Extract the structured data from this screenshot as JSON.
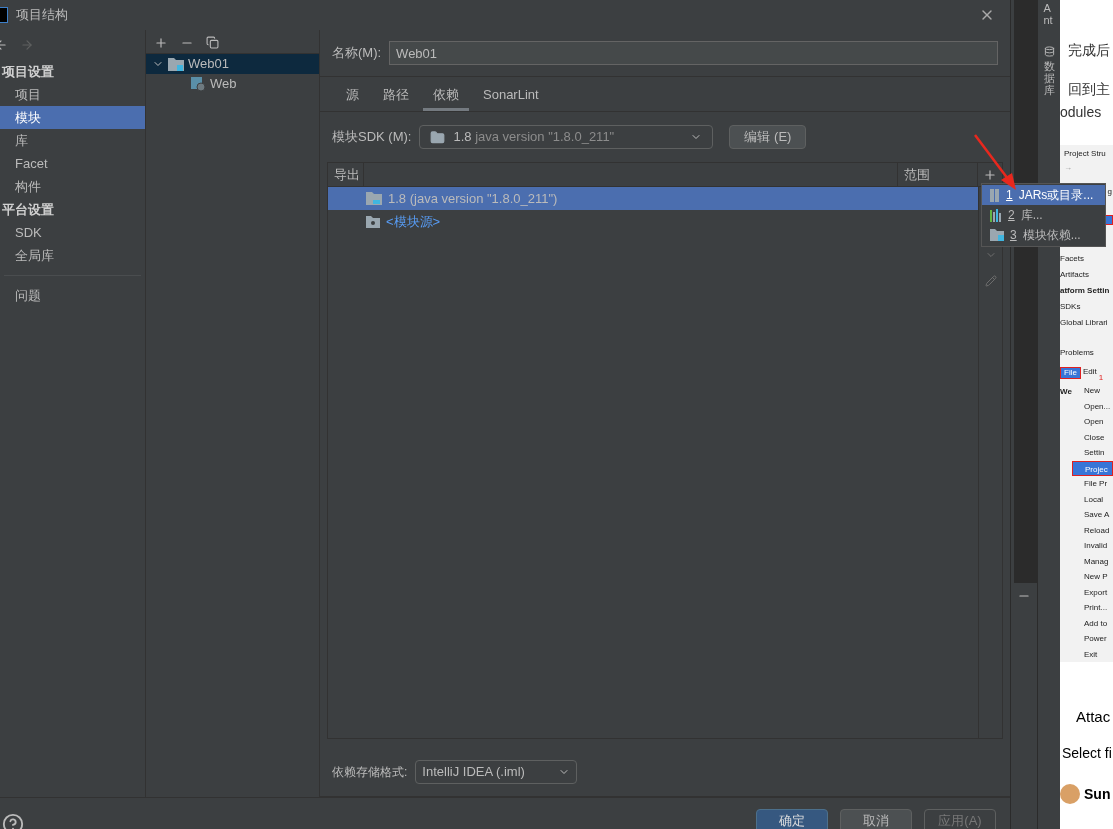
{
  "window": {
    "title": "项目结构"
  },
  "nav": {
    "items": [
      {
        "label": "项目设置",
        "kind": "header"
      },
      {
        "label": "项目",
        "kind": "item",
        "selected": false
      },
      {
        "label": "模块",
        "kind": "item",
        "selected": true
      },
      {
        "label": "库",
        "kind": "item",
        "selected": false
      },
      {
        "label": "Facet",
        "kind": "item",
        "selected": false
      },
      {
        "label": "构件",
        "kind": "item",
        "selected": false
      },
      {
        "label": "平台设置",
        "kind": "header"
      },
      {
        "label": "SDK",
        "kind": "item",
        "selected": false
      },
      {
        "label": "全局库",
        "kind": "item",
        "selected": false
      },
      {
        "kind": "divider"
      },
      {
        "label": "问题",
        "kind": "item",
        "selected": false
      }
    ]
  },
  "module_tree": [
    {
      "label": "Web01",
      "kind": "module",
      "expanded": true,
      "selected": true,
      "children": [
        {
          "label": "Web",
          "kind": "facet",
          "selected": false
        }
      ]
    }
  ],
  "name_field": {
    "label": "名称(M):",
    "value": "Web01"
  },
  "tabs": [
    {
      "label": "源",
      "selected": false
    },
    {
      "label": "路径",
      "selected": false
    },
    {
      "label": "依赖",
      "selected": true
    },
    {
      "label": "SonarLint",
      "selected": false
    }
  ],
  "sdk": {
    "label": "模块SDK (M):",
    "version": "1.8",
    "detail": "java version \"1.8.0_211\"",
    "edit_button": "编辑 (E)"
  },
  "table": {
    "columns": [
      "导出",
      "范围"
    ],
    "rows": [
      {
        "label": "1.8 (java version \"1.8.0_211\")",
        "kind": "sdk",
        "selected": true
      },
      {
        "label": "<模块源>",
        "kind": "source",
        "selected": false
      }
    ]
  },
  "add_menu": [
    {
      "number": "1",
      "label": "JARs或目录...",
      "kind": "jar",
      "selected": true
    },
    {
      "number": "2",
      "label": "库...",
      "kind": "library",
      "selected": false
    },
    {
      "number": "3",
      "label": "模块依赖...",
      "kind": "module",
      "selected": false
    }
  ],
  "storage_format": {
    "label": "依赖存储格式:",
    "value": "IntelliJ IDEA (.iml)"
  },
  "buttons": [
    {
      "label": "确定",
      "kind": "primary",
      "disabled": false
    },
    {
      "label": "取消",
      "kind": "normal",
      "disabled": false
    },
    {
      "label": "应用(A)",
      "kind": "normal",
      "disabled": true
    }
  ],
  "tool_strip": [
    "Ant",
    "数据库"
  ],
  "background_page": {
    "lines": [
      "完成后",
      "回到主",
      "odules"
    ],
    "screenshot": {
      "title": "Project Stru",
      "arrow": "→",
      "sidebar": [
        {
          "text": "g",
          "kind": "clipped"
        },
        {
          "kind": "highlight"
        },
        {
          "text": "Facets",
          "kind": "text"
        },
        {
          "text": "Artifacts",
          "kind": "text"
        },
        {
          "text": "atform Settin",
          "kind": "bold"
        },
        {
          "text": "SDKs",
          "kind": "text"
        },
        {
          "text": "Global Librari",
          "kind": "text"
        },
        {
          "text": "Problems",
          "kind": "section"
        }
      ],
      "menu_bar": [
        "File",
        "Edit"
      ],
      "marker": "1",
      "side_text": "We",
      "menu": [
        {
          "text": "New",
          "selected": false
        },
        {
          "text": "Open...",
          "selected": false
        },
        {
          "text": "Open",
          "selected": false
        },
        {
          "text": "Close",
          "selected": false
        },
        {
          "text": "Settin",
          "selected": false
        },
        {
          "text": "Projec",
          "selected": true
        },
        {
          "text": "File Pr",
          "selected": false
        },
        {
          "text": "Local",
          "selected": false
        },
        {
          "text": "Save A",
          "selected": false
        },
        {
          "text": "Reload",
          "selected": false
        },
        {
          "text": "Invalid",
          "selected": false
        },
        {
          "text": "Manag",
          "selected": false
        },
        {
          "text": "New P",
          "selected": false
        },
        {
          "text": "Export",
          "selected": false
        },
        {
          "text": "Print...",
          "selected": false
        },
        {
          "text": "Add to",
          "selected": false
        },
        {
          "text": "Power",
          "selected": false
        },
        {
          "text": "Exit",
          "selected": false
        }
      ]
    },
    "after": [
      "Attac",
      "Select fi",
      "Sun"
    ]
  }
}
